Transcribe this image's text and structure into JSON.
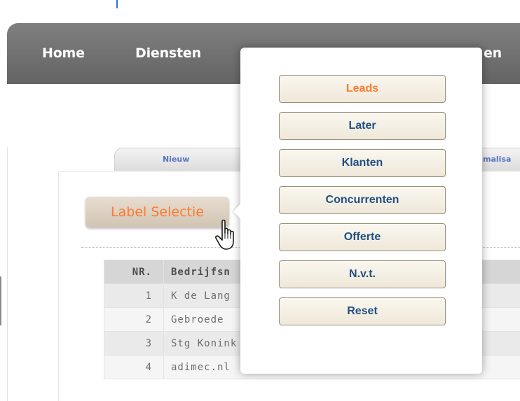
{
  "nav": {
    "items": [
      {
        "label": "Home"
      },
      {
        "label": "Diensten"
      },
      {
        "label": "en"
      }
    ]
  },
  "tabs": {
    "items": [
      {
        "label": "Nieuw"
      },
      {
        "label": "malisa"
      }
    ]
  },
  "label_selectie": {
    "label": "Label Selectie"
  },
  "popup": {
    "buttons": [
      {
        "label": "Leads",
        "active": true
      },
      {
        "label": "Later"
      },
      {
        "label": "Klanten"
      },
      {
        "label": "Concurrenten"
      },
      {
        "label": "Offerte"
      },
      {
        "label": "N.v.t."
      },
      {
        "label": "Reset"
      }
    ]
  },
  "table": {
    "headers": [
      "NR.",
      "Bedrijfsn"
    ],
    "rows": [
      {
        "nr": "1",
        "name": "K de Lang"
      },
      {
        "nr": "2",
        "name": "Gebroede"
      },
      {
        "nr": "3",
        "name": "Stg Konink"
      },
      {
        "nr": "4",
        "name": "adimec.nl"
      }
    ]
  },
  "colors": {
    "nav_bg": "#6e6e6e",
    "accent_orange": "#ff7a2e",
    "button_text_blue": "#1f4f84",
    "tab_text_blue": "#5a74c4"
  },
  "icons": {
    "cursor": "hand-pointer-icon"
  }
}
